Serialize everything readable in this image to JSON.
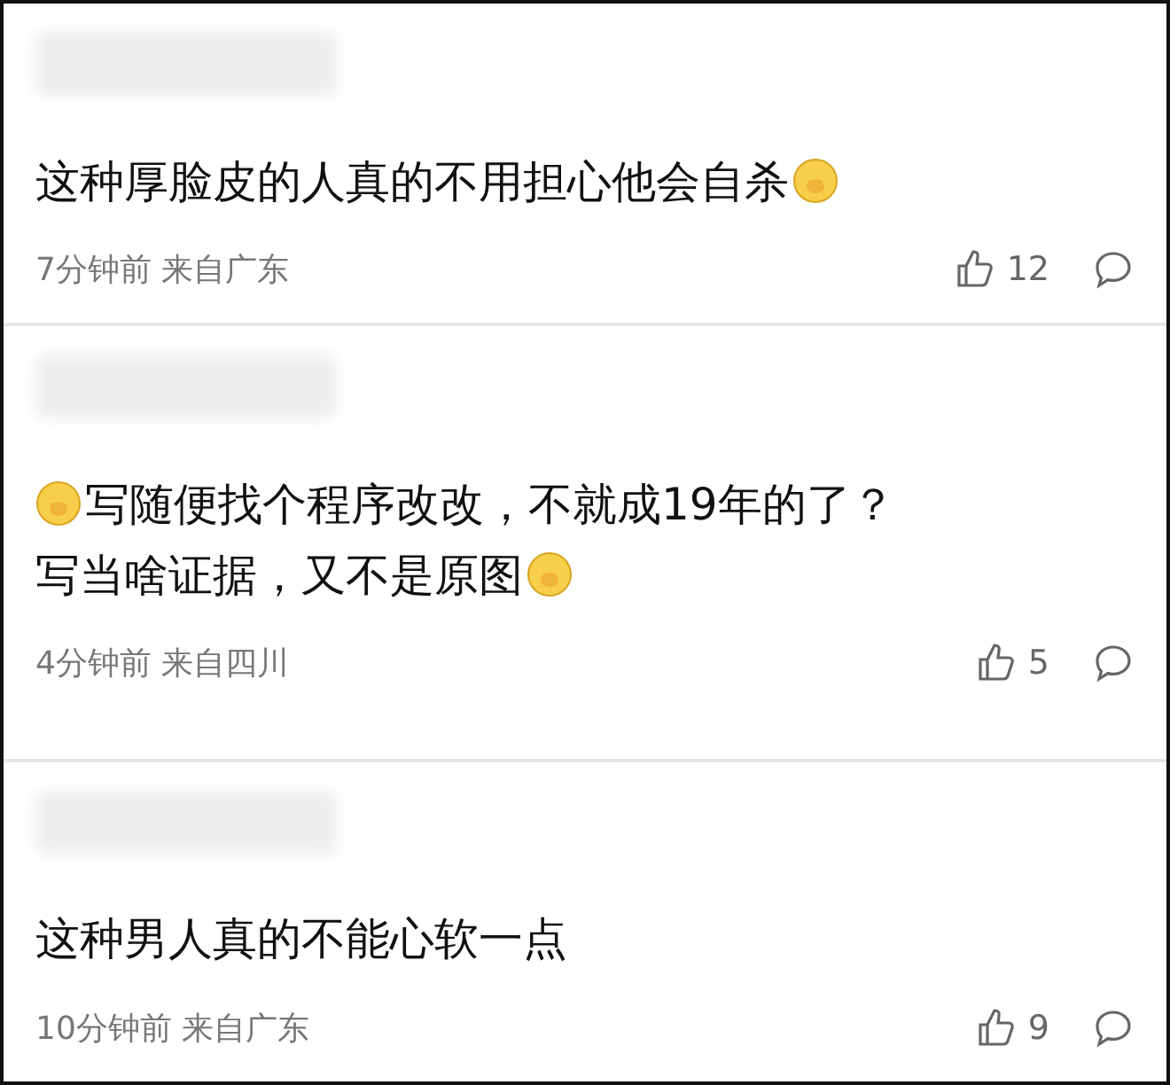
{
  "comments": [
    {
      "lines": [
        [
          {
            "kind": "text",
            "text": "这种厚脸皮的人真的不用担心他会自杀"
          },
          {
            "kind": "emoji"
          }
        ]
      ],
      "meta": "7分钟前 来自广东",
      "likes": "12"
    },
    {
      "lines": [
        [
          {
            "kind": "emoji"
          },
          {
            "kind": "text",
            "text": "写随便找个程序改改，不就成19年的了？"
          }
        ],
        [
          {
            "kind": "text",
            "text": "写当啥证据，又不是原图"
          },
          {
            "kind": "emoji"
          }
        ]
      ],
      "meta": "4分钟前 来自四川",
      "likes": "5"
    },
    {
      "lines": [
        [
          {
            "kind": "text",
            "text": "这种男人真的不能心软一点"
          }
        ]
      ],
      "meta": "10分钟前 来自广东",
      "likes": "9"
    }
  ]
}
